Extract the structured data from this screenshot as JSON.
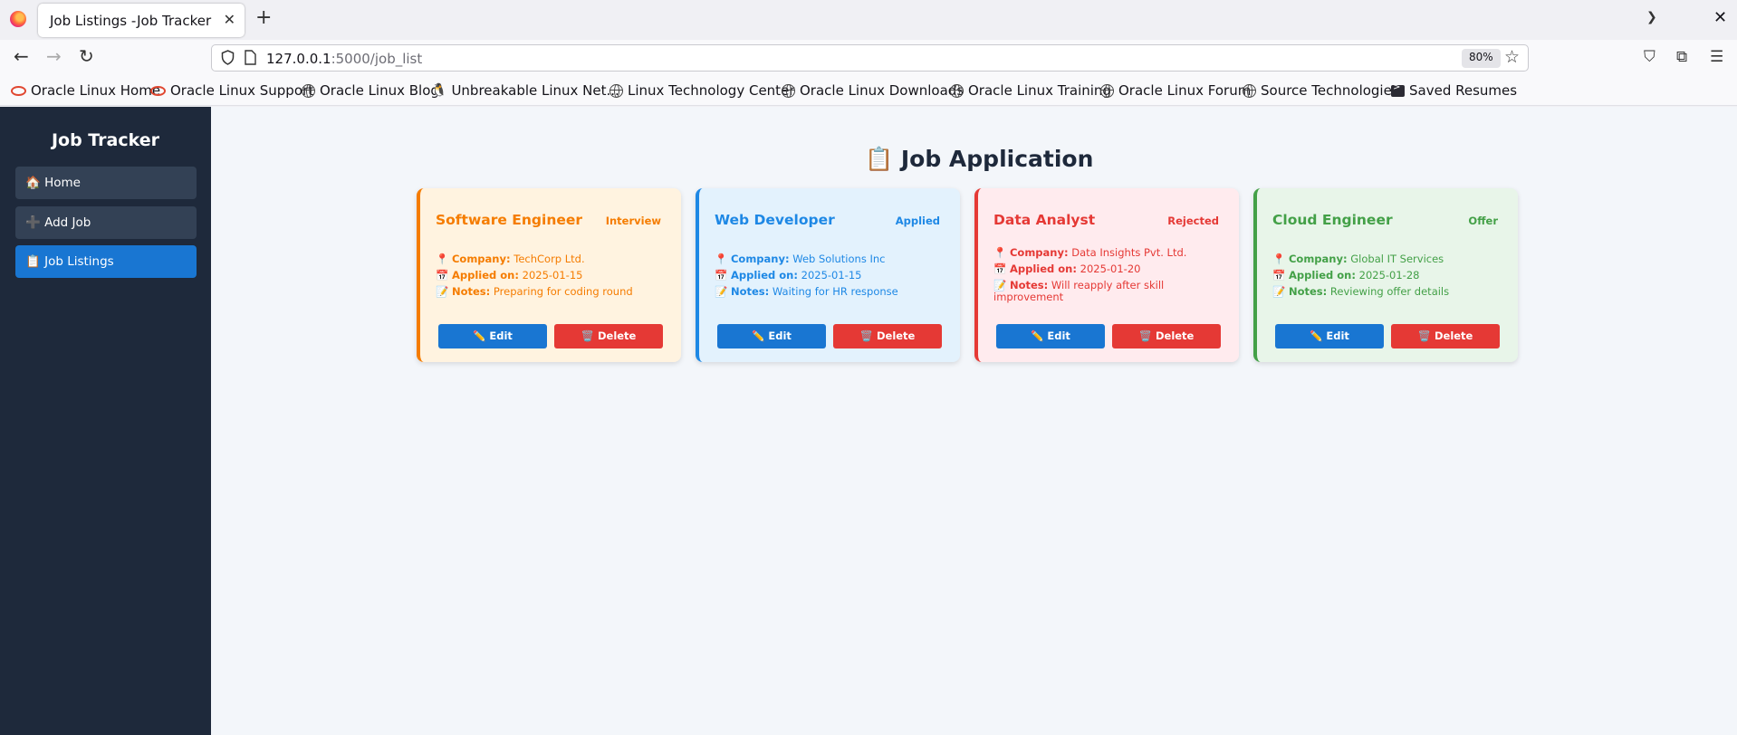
{
  "browser": {
    "tab_title": "Job Listings -Job Tracker",
    "url_host": "127.0.0.1",
    "url_path": ":5000/job_list",
    "zoom": "80%"
  },
  "bookmarks": [
    {
      "label": "Oracle Linux Home",
      "icon": "oracle"
    },
    {
      "label": "Oracle Linux Support",
      "icon": "oracle"
    },
    {
      "label": "Oracle Linux Blog",
      "icon": "globe"
    },
    {
      "label": "Unbreakable Linux Net...",
      "icon": "penguin"
    },
    {
      "label": "Linux Technology Center",
      "icon": "globe"
    },
    {
      "label": "Oracle Linux Downloads",
      "icon": "globe"
    },
    {
      "label": "Oracle Linux Training",
      "icon": "globe"
    },
    {
      "label": "Oracle Linux Forum",
      "icon": "globe"
    },
    {
      "label": "Source Technologies",
      "icon": "globe"
    },
    {
      "label": "Saved Resumes",
      "icon": "terminal"
    }
  ],
  "sidebar": {
    "title": "Job Tracker",
    "items": [
      {
        "icon": "🏠",
        "label": "Home"
      },
      {
        "icon": "➕",
        "label": "Add Job"
      },
      {
        "icon": "📋",
        "label": "Job Listings"
      }
    ]
  },
  "main": {
    "title_icon": "📋",
    "title": "Job Application",
    "labels": {
      "company": "Company:",
      "applied": "Applied on:",
      "notes": "Notes:"
    },
    "edit_label": "Edit",
    "delete_label": "Delete",
    "edit_icon": "✏️",
    "delete_icon": "🗑️",
    "jobs": [
      {
        "title": "Software Engineer",
        "status": "Interview",
        "company": "TechCorp Ltd.",
        "applied": "2025-01-15",
        "notes": "Preparing for coding round",
        "accent": "#f57c00",
        "bg": "#fff3e0"
      },
      {
        "title": "Web Developer",
        "status": "Applied",
        "company": "Web Solutions Inc",
        "applied": "2025-01-15",
        "notes": "Waiting for HR response",
        "accent": "#1e88e5",
        "bg": "#e3f2fd"
      },
      {
        "title": "Data Analyst",
        "status": "Rejected",
        "company": "Data Insights Pvt. Ltd.",
        "applied": "2025-01-20",
        "notes": "Will reapply after skill improvement",
        "accent": "#e53935",
        "bg": "#ffebee"
      },
      {
        "title": "Cloud Engineer",
        "status": "Offer",
        "company": "Global IT Services",
        "applied": "2025-01-28",
        "notes": "Reviewing offer details",
        "accent": "#43a047",
        "bg": "#e8f5e9"
      }
    ]
  }
}
